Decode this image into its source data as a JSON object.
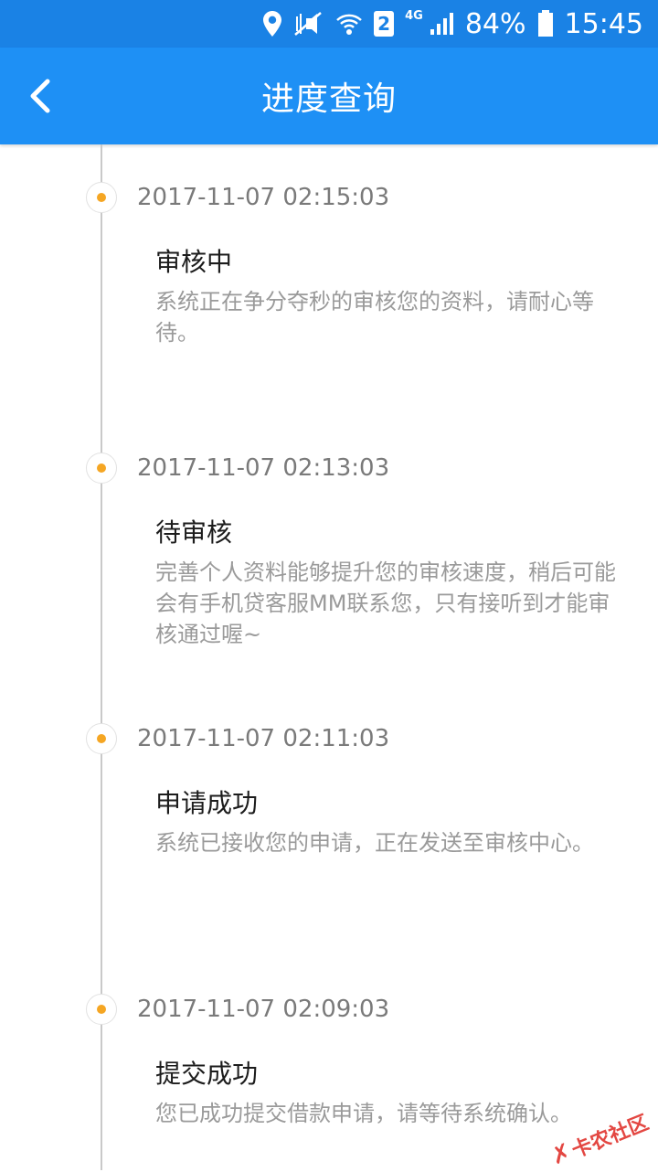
{
  "status_bar": {
    "network": "4G",
    "sim_slot": "2",
    "battery": "84%",
    "time": "15:45"
  },
  "header": {
    "title": "进度查询"
  },
  "timeline": [
    {
      "time": "2017-11-07 02:15:03",
      "status": "审核中",
      "description": "系统正在争分夺秒的审核您的资料，请耐心等待。"
    },
    {
      "time": "2017-11-07 02:13:03",
      "status": "待审核",
      "description": "完善个人资料能够提升您的审核速度，稍后可能会有手机贷客服MM联系您，只有接听到才能审核通过喔~"
    },
    {
      "time": "2017-11-07 02:11:03",
      "status": "申请成功",
      "description": "系统已接收您的申请，正在发送至审核中心。"
    },
    {
      "time": "2017-11-07 02:09:03",
      "status": "提交成功",
      "description": "您已成功提交借款申请，请等待系统确认。"
    }
  ],
  "watermark": {
    "text": "卡农社区",
    "mark": "✗"
  },
  "colors": {
    "primary": "#1e90f5",
    "status_bar": "#1a82e5",
    "accent_dot": "#f5a623"
  }
}
